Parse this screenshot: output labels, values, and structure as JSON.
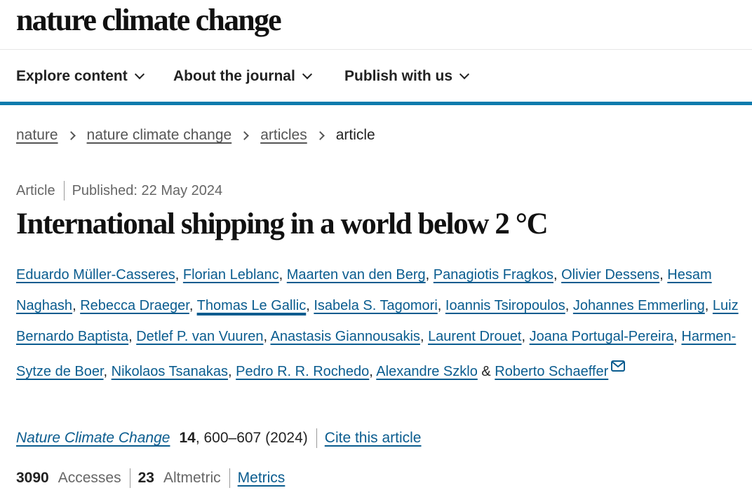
{
  "site": {
    "logo": "nature climate change"
  },
  "nav": {
    "items": [
      {
        "label": "Explore content",
        "icon": "chevron-down-icon"
      },
      {
        "label": "About the journal",
        "icon": "chevron-down-icon"
      },
      {
        "label": "Publish with us",
        "icon": "chevron-down-icon"
      }
    ],
    "accent_color": "#0e7bad"
  },
  "breadcrumb": {
    "items": [
      "nature",
      "nature climate change",
      "articles"
    ],
    "current": "article"
  },
  "article": {
    "type": "Article",
    "published": "Published: 22 May 2024",
    "title": "International shipping in a world below 2  °C",
    "authors": [
      "Eduardo Müller-Casseres",
      "Florian Leblanc",
      "Maarten van den Berg",
      "Panagiotis Fragkos",
      "Olivier Dessens",
      "Hesam Naghash",
      "Rebecca Draeger",
      "Thomas Le Gallic",
      "Isabela S. Tagomori",
      "Ioannis Tsiropoulos",
      "Johannes Emmerling",
      "Luiz Bernardo Baptista",
      "Detlef P. van Vuuren",
      "Anastasis Giannousakis",
      "Laurent Drouet",
      "Joana Portugal-Pereira",
      "Harmen-Sytze de Boer",
      "Nikolaos Tsanakas",
      "Pedro R. R. Rochedo",
      "Alexandre Szklo",
      "Roberto Schaeffer"
    ],
    "focused_author": "Thomas Le Gallic",
    "conjunction": "&",
    "corresponding_icon": "mail-icon",
    "link_color": "#0a5c8f"
  },
  "citation": {
    "journal": "Nature Climate Change",
    "volume": "14",
    "pages_year": ", 600–607 (2024)",
    "cite_label": "Cite this article"
  },
  "metrics": {
    "accesses_count": "3090",
    "accesses_label": "Accesses",
    "altmetric_count": "23",
    "altmetric_label": "Altmetric",
    "metrics_label": "Metrics"
  }
}
